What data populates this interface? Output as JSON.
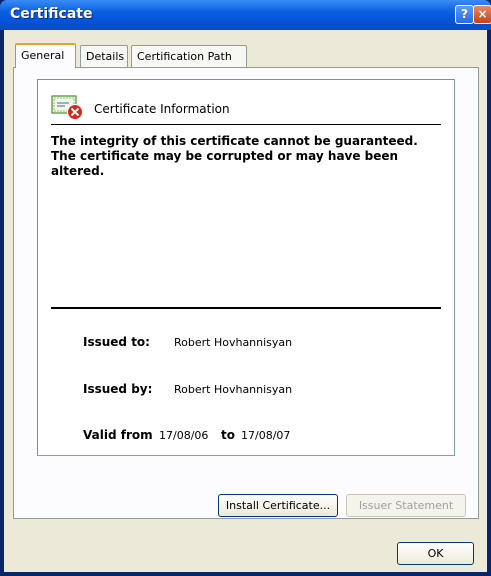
{
  "window": {
    "title": "Certificate"
  },
  "titlebar": {
    "help_glyph": "?",
    "close_glyph": "×"
  },
  "tabs": [
    {
      "label": "General"
    },
    {
      "label": "Details"
    },
    {
      "label": "Certification Path"
    }
  ],
  "info": {
    "heading": "Certificate Information",
    "warning": "The integrity of this certificate cannot be guaranteed. The certificate may be corrupted or may have been altered.",
    "issued_to_label": "Issued to:",
    "issued_to_value": "Robert Hovhannisyan",
    "issued_by_label": "Issued by:",
    "issued_by_value": "Robert Hovhannisyan",
    "valid_from_label": "Valid from",
    "valid_from_value": "17/08/06",
    "valid_to_label": "to",
    "valid_to_value": "17/08/07"
  },
  "buttons": {
    "install": "Install Certificate...",
    "issuer_statement": "Issuer Statement",
    "ok": "OK"
  },
  "icons": {
    "certificate": "certificate-error-icon",
    "help": "help-icon",
    "close": "close-icon"
  }
}
